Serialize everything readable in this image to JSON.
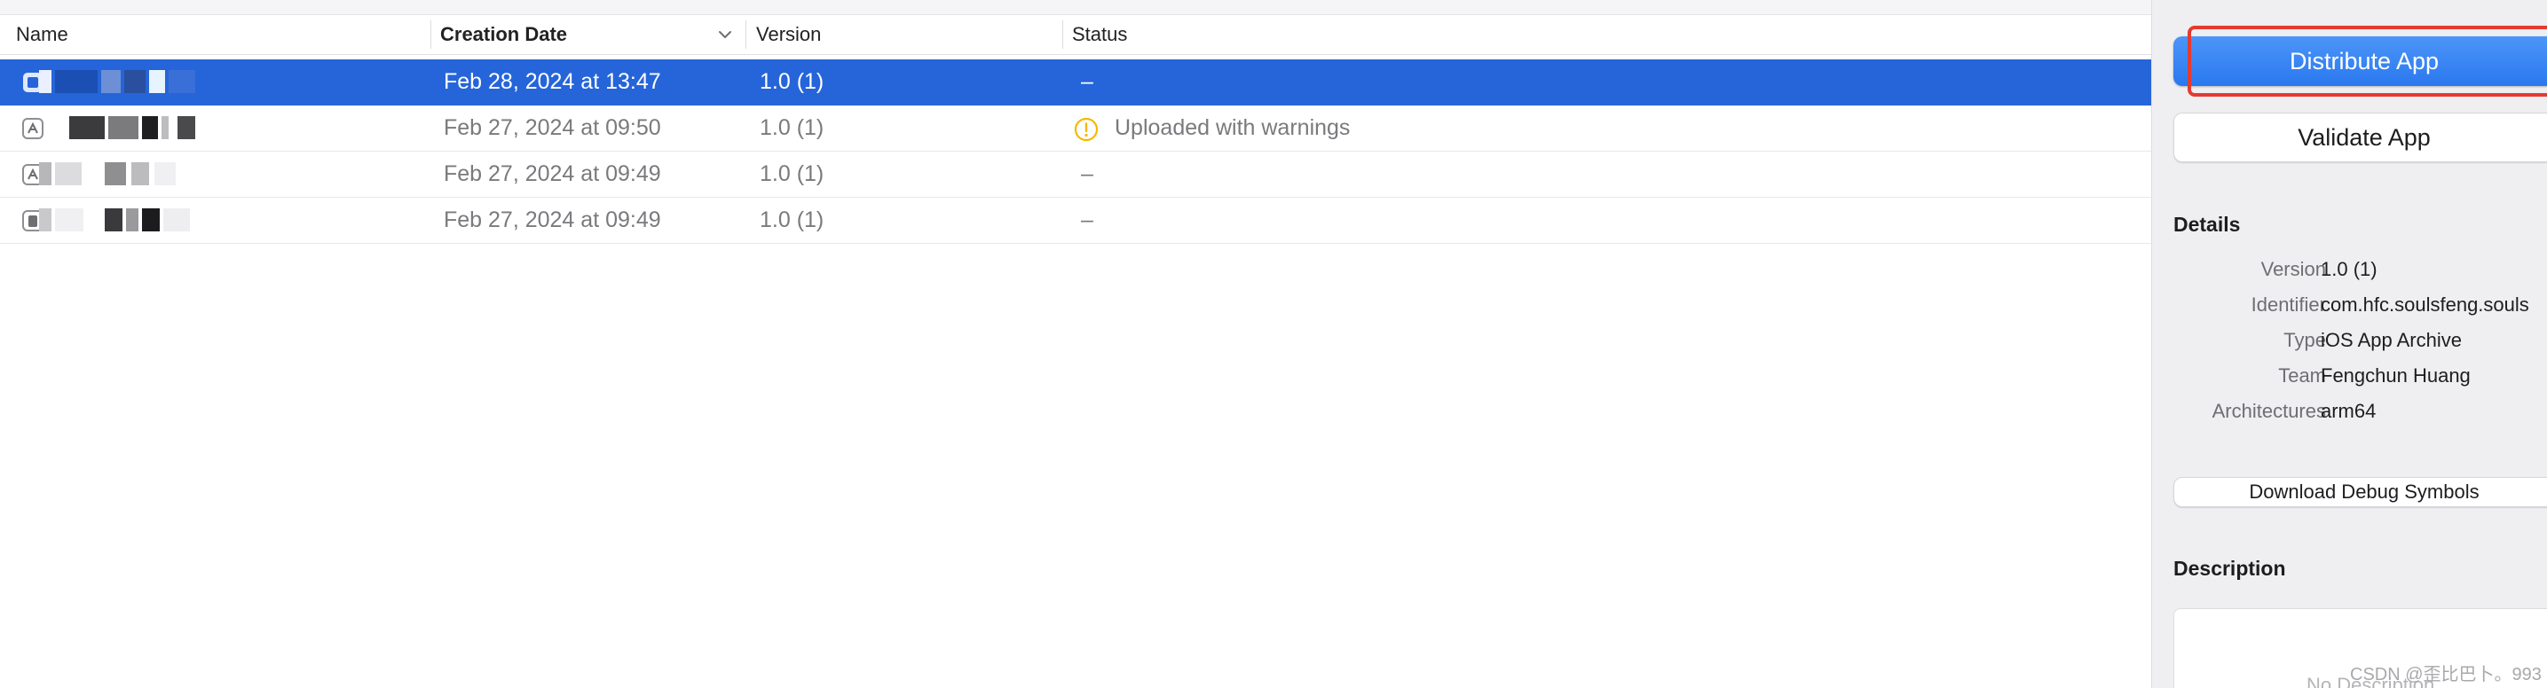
{
  "list": {
    "columns": {
      "name": "Name",
      "creation_date": "Creation Date",
      "version": "Version",
      "status": "Status"
    },
    "rows": [
      {
        "date": "Feb 28, 2024 at 13:47",
        "version": "1.0 (1)",
        "status": "–",
        "selected": true
      },
      {
        "date": "Feb 27, 2024 at 09:50",
        "version": "1.0 (1)",
        "status": "Uploaded with warnings",
        "status_icon": "warning-icon"
      },
      {
        "date": "Feb 27, 2024 at 09:49",
        "version": "1.0 (1)",
        "status": "–"
      },
      {
        "date": "Feb 27, 2024 at 09:49",
        "version": "1.0 (1)",
        "status": "–"
      }
    ],
    "sort_icon": "chevron-down-icon",
    "app_icon": "app-archive-icon"
  },
  "inspector": {
    "distribute_label": "Distribute App",
    "validate_label": "Validate App",
    "details_title": "Details",
    "details": [
      {
        "key": "Version",
        "value": "1.0 (1)"
      },
      {
        "key": "Identifier",
        "value": "com.hfc.soulsfeng.souls"
      },
      {
        "key": "Type",
        "value": "iOS App Archive"
      },
      {
        "key": "Team",
        "value": "Fengchun Huang"
      },
      {
        "key": "Architectures",
        "value": "arm64"
      }
    ],
    "debug_symbols_label": "Download Debug Symbols",
    "description_title": "Description",
    "description_placeholder": "No Description"
  },
  "watermark": "CSDN @歪比巴卜。993",
  "colors": {
    "selection": "#2565d9",
    "primary_button": "#2a78ef",
    "highlight_box": "#e53a30",
    "warning": "#f5b800"
  }
}
